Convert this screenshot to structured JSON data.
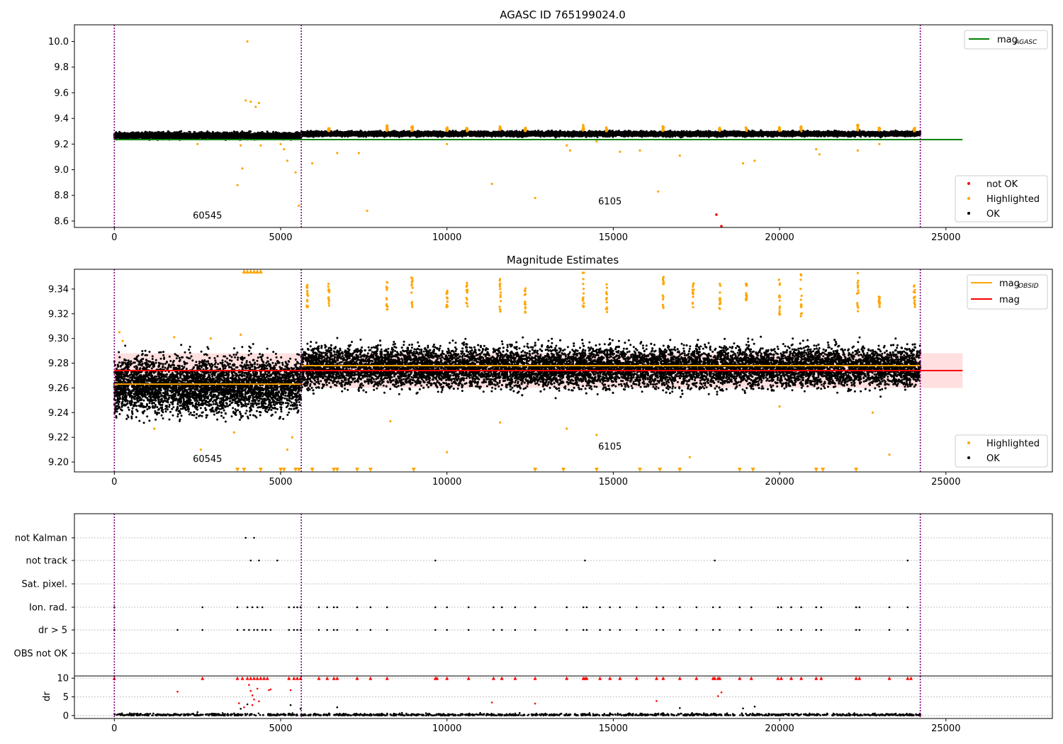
{
  "colors": {
    "ok": "#000000",
    "highlighted": "#ffa500",
    "not_ok": "#ff0000",
    "agasc_line": "#008000",
    "obsid_line": "#ffa500",
    "mag_line": "#ff0000",
    "mag_band": "#ffd7d7",
    "obsid_divider": "#800080",
    "grid": "#b0b0b0"
  },
  "chart_data": [
    {
      "type": "scatter",
      "title": "AGASC ID 765199024.0",
      "xlim": [
        -1200,
        28200
      ],
      "ylim": [
        8.55,
        10.13
      ],
      "x_ticks": [
        0,
        5000,
        10000,
        15000,
        20000,
        25000
      ],
      "x_tick_labels": [
        "0",
        "5000",
        "10000",
        "15000",
        "20000",
        "25000"
      ],
      "y_ticks": [
        8.6,
        8.8,
        9.0,
        9.2,
        9.4,
        9.6,
        9.8,
        10.0
      ],
      "y_tick_labels": [
        "8.6",
        "8.8",
        "9.0",
        "9.2",
        "9.4",
        "9.6",
        "9.8",
        "10.0"
      ],
      "obsid_boundaries": [
        0,
        5620,
        24230
      ],
      "obsid_labels": [
        {
          "text": "60545",
          "x": 2800,
          "y": 8.62
        },
        {
          "text": "6105",
          "x": 14900,
          "y": 8.73
        }
      ],
      "lines": [
        {
          "name": "agasc",
          "legend_label": "mag",
          "legend_sub": "AGASC",
          "x": [
            0,
            25500
          ],
          "y": [
            9.235,
            9.235
          ]
        }
      ],
      "ok_band": [
        {
          "x": [
            0,
            5620
          ],
          "center": 9.265,
          "spread": 0.012
        },
        {
          "x": [
            5620,
            24230
          ],
          "center": 9.28,
          "spread": 0.009
        }
      ],
      "highlighted_points": [
        [
          4000,
          10.0
        ],
        [
          3950,
          9.54
        ],
        [
          4100,
          9.53
        ],
        [
          4250,
          9.49
        ],
        [
          4350,
          9.52
        ],
        [
          3700,
          8.88
        ],
        [
          3850,
          9.01
        ],
        [
          3800,
          9.19
        ],
        [
          4400,
          9.19
        ],
        [
          2500,
          9.2
        ],
        [
          5000,
          9.2
        ],
        [
          5100,
          9.16
        ],
        [
          5200,
          9.07
        ],
        [
          5450,
          8.98
        ],
        [
          5550,
          8.72
        ],
        [
          5950,
          9.05
        ],
        [
          6700,
          9.13
        ],
        [
          7350,
          9.13
        ],
        [
          7600,
          8.68
        ],
        [
          10000,
          9.2
        ],
        [
          11350,
          8.89
        ],
        [
          12650,
          8.78
        ],
        [
          13600,
          9.19
        ],
        [
          13700,
          9.15
        ],
        [
          14500,
          9.22
        ],
        [
          15200,
          9.14
        ],
        [
          15800,
          9.15
        ],
        [
          16350,
          8.83
        ],
        [
          17000,
          9.11
        ],
        [
          18900,
          9.05
        ],
        [
          19250,
          9.07
        ],
        [
          21100,
          9.16
        ],
        [
          21200,
          9.12
        ],
        [
          22350,
          9.15
        ],
        [
          23000,
          9.2
        ]
      ],
      "highlighted_clusters": [
        {
          "x": 6450,
          "y_from": 9.3,
          "y_to": 9.34
        },
        {
          "x": 8200,
          "y_from": 9.3,
          "y_to": 9.35
        },
        {
          "x": 8950,
          "y_from": 9.3,
          "y_to": 9.34
        },
        {
          "x": 10000,
          "y_from": 9.3,
          "y_to": 9.33
        },
        {
          "x": 10600,
          "y_from": 9.3,
          "y_to": 9.33
        },
        {
          "x": 11600,
          "y_from": 9.3,
          "y_to": 9.34
        },
        {
          "x": 12350,
          "y_from": 9.3,
          "y_to": 9.33
        },
        {
          "x": 14100,
          "y_from": 9.3,
          "y_to": 9.35
        },
        {
          "x": 14800,
          "y_from": 9.3,
          "y_to": 9.33
        },
        {
          "x": 16500,
          "y_from": 9.3,
          "y_to": 9.34
        },
        {
          "x": 18200,
          "y_from": 9.3,
          "y_to": 9.33
        },
        {
          "x": 19000,
          "y_from": 9.3,
          "y_to": 9.33
        },
        {
          "x": 20000,
          "y_from": 9.3,
          "y_to": 9.34
        },
        {
          "x": 20650,
          "y_from": 9.3,
          "y_to": 9.34
        },
        {
          "x": 22350,
          "y_from": 9.3,
          "y_to": 9.35
        },
        {
          "x": 23000,
          "y_from": 9.3,
          "y_to": 9.33
        },
        {
          "x": 24050,
          "y_from": 9.3,
          "y_to": 9.33
        }
      ],
      "not_ok_points": [
        [
          18100,
          8.65
        ],
        [
          18250,
          8.56
        ]
      ],
      "legends": [
        {
          "placement": "upper-right",
          "entries": [
            {
              "kind": "line",
              "color": "agasc_line",
              "label": "mag",
              "sub": "AGASC"
            }
          ]
        },
        {
          "placement": "lower-right",
          "entries": [
            {
              "kind": "marker",
              "color": "not_ok",
              "label": "not OK"
            },
            {
              "kind": "marker",
              "color": "highlighted",
              "label": "Highlighted"
            },
            {
              "kind": "marker",
              "color": "ok",
              "label": "OK"
            }
          ]
        }
      ]
    },
    {
      "type": "scatter",
      "title": "Magnitude Estimates",
      "xlim": [
        -1200,
        28200
      ],
      "ylim": [
        9.192,
        9.356
      ],
      "x_ticks": [
        0,
        5000,
        10000,
        15000,
        20000,
        25000
      ],
      "x_tick_labels": [
        "0",
        "5000",
        "10000",
        "15000",
        "20000",
        "25000"
      ],
      "y_ticks": [
        9.2,
        9.22,
        9.24,
        9.26,
        9.28,
        9.3,
        9.32,
        9.34
      ],
      "y_tick_labels": [
        "9.20",
        "9.22",
        "9.24",
        "9.26",
        "9.28",
        "9.30",
        "9.32",
        "9.34"
      ],
      "obsid_boundaries": [
        0,
        5620,
        24230
      ],
      "obsid_labels": [
        {
          "text": "60545",
          "x": 2800,
          "y": 9.2
        },
        {
          "text": "6105",
          "x": 14900,
          "y": 9.21
        }
      ],
      "lines": [
        {
          "name": "mag_obsid_1",
          "x": [
            0,
            5620
          ],
          "y": [
            9.263,
            9.263
          ],
          "color": "obsid_line"
        },
        {
          "name": "mag_obsid_2",
          "x": [
            5620,
            24230
          ],
          "y": [
            9.278,
            9.278
          ],
          "color": "obsid_line"
        },
        {
          "name": "mag",
          "x": [
            0,
            25500
          ],
          "y": [
            9.274,
            9.274
          ],
          "color": "mag_line"
        }
      ],
      "band": {
        "x": [
          0,
          25500
        ],
        "y": [
          9.26,
          9.288
        ]
      },
      "ok_band": [
        {
          "x": [
            0,
            5620
          ],
          "center": 9.262,
          "spread": 0.011
        },
        {
          "x": [
            5620,
            24230
          ],
          "center": 9.277,
          "spread": 0.008
        }
      ],
      "highlighted_points": [
        [
          150,
          9.305
        ],
        [
          250,
          9.298
        ],
        [
          1200,
          9.227
        ],
        [
          2600,
          9.21
        ],
        [
          3600,
          9.224
        ],
        [
          5200,
          9.21
        ],
        [
          5350,
          9.22
        ],
        [
          5800,
          9.33
        ],
        [
          10000,
          9.208
        ],
        [
          13600,
          9.227
        ],
        [
          14500,
          9.222
        ],
        [
          17300,
          9.204
        ],
        [
          23300,
          9.206
        ],
        [
          11600,
          9.232
        ],
        [
          8300,
          9.233
        ],
        [
          1800,
          9.301
        ],
        [
          3800,
          9.303
        ],
        [
          2900,
          9.3
        ],
        [
          20000,
          9.245
        ],
        [
          22800,
          9.24
        ]
      ],
      "highlighted_clusters": [
        {
          "x": 5800,
          "y_from": 9.325,
          "y_to": 9.345
        },
        {
          "x": 6450,
          "y_from": 9.325,
          "y_to": 9.345
        },
        {
          "x": 8200,
          "y_from": 9.322,
          "y_to": 9.35
        },
        {
          "x": 8950,
          "y_from": 9.325,
          "y_to": 9.35
        },
        {
          "x": 10000,
          "y_from": 9.325,
          "y_to": 9.34
        },
        {
          "x": 10600,
          "y_from": 9.325,
          "y_to": 9.345
        },
        {
          "x": 11600,
          "y_from": 9.32,
          "y_to": 9.35
        },
        {
          "x": 12350,
          "y_from": 9.32,
          "y_to": 9.345
        },
        {
          "x": 14100,
          "y_from": 9.325,
          "y_to": 9.355
        },
        {
          "x": 14800,
          "y_from": 9.32,
          "y_to": 9.345
        },
        {
          "x": 16500,
          "y_from": 9.32,
          "y_to": 9.35
        },
        {
          "x": 17400,
          "y_from": 9.325,
          "y_to": 9.345
        },
        {
          "x": 18200,
          "y_from": 9.32,
          "y_to": 9.345
        },
        {
          "x": 19000,
          "y_from": 9.33,
          "y_to": 9.345
        },
        {
          "x": 20000,
          "y_from": 9.318,
          "y_to": 9.348
        },
        {
          "x": 20650,
          "y_from": 9.318,
          "y_to": 9.352
        },
        {
          "x": 22350,
          "y_from": 9.32,
          "y_to": 9.355
        },
        {
          "x": 23000,
          "y_from": 9.325,
          "y_to": 9.335
        },
        {
          "x": 24050,
          "y_from": 9.325,
          "y_to": 9.345
        }
      ],
      "offscale_high_x": [
        3900,
        4000,
        4100,
        4200,
        4300,
        4400
      ],
      "offscale_low_x": [
        3700,
        3900,
        4400,
        5000,
        5100,
        5450,
        5550,
        5950,
        6600,
        6700,
        7300,
        7700,
        9000,
        12650,
        13500,
        14500,
        15800,
        16400,
        17000,
        18800,
        19200,
        21100,
        21300,
        22300
      ],
      "legends": [
        {
          "placement": "upper-right",
          "entries": [
            {
              "kind": "line",
              "color": "obsid_line",
              "label": "mag",
              "sub": "OBSID"
            },
            {
              "kind": "line",
              "color": "mag_line",
              "label": "mag",
              "sub": ""
            }
          ]
        },
        {
          "placement": "lower-right",
          "entries": [
            {
              "kind": "marker",
              "color": "highlighted",
              "label": "Highlighted"
            },
            {
              "kind": "marker",
              "color": "ok",
              "label": "OK"
            }
          ]
        }
      ]
    },
    {
      "type": "scatter",
      "title": "",
      "xlim": [
        -1200,
        28200
      ],
      "categories": [
        "not Kalman",
        "not track",
        "Sat. pixel.",
        "Ion. rad.",
        "dr > 5",
        "OBS not OK"
      ],
      "obsid_boundaries": [
        0,
        5620,
        24230
      ],
      "flag_points": {
        "not Kalman": [
          3950,
          4200
        ],
        "not track": [
          4100,
          4350,
          4900,
          9650,
          14150,
          18050,
          23850
        ],
        "Sat. pixel.": [],
        "Ion. rad.": [
          0,
          2650,
          3700,
          4000,
          4150,
          4300,
          4450,
          5250,
          5400,
          5500,
          5600,
          6150,
          6400,
          6600,
          6700,
          7300,
          7700,
          8200,
          9650,
          10000,
          10650,
          11400,
          11650,
          12050,
          12650,
          13600,
          14100,
          14200,
          14600,
          14900,
          15200,
          15700,
          16300,
          16500,
          17000,
          17500,
          18000,
          18200,
          18800,
          19150,
          19950,
          20050,
          20350,
          20650,
          21100,
          21250,
          22300,
          22400,
          23300,
          23850
        ],
        "dr > 5": [
          0,
          1900,
          2650,
          3700,
          3900,
          4050,
          4200,
          4300,
          4450,
          4550,
          4700,
          5250,
          5400,
          5500,
          5600,
          6150,
          6400,
          6600,
          6700,
          7300,
          7700,
          8200,
          9650,
          10000,
          10650,
          11400,
          11650,
          12050,
          12650,
          13600,
          14100,
          14200,
          14600,
          14900,
          15200,
          15700,
          16300,
          16500,
          17000,
          17500,
          18000,
          18200,
          18800,
          19150,
          19950,
          20050,
          20350,
          20650,
          21100,
          21250,
          22300,
          22400,
          23300,
          23850
        ],
        "OBS not OK": []
      }
    },
    {
      "type": "scatter",
      "title": "",
      "ylabel": "dr",
      "xlim": [
        -1200,
        28200
      ],
      "ylim": [
        -0.8,
        10.6
      ],
      "x_ticks": [
        0,
        5000,
        10000,
        15000,
        20000,
        25000
      ],
      "x_tick_labels": [
        "0",
        "5000",
        "10000",
        "15000",
        "20000",
        "25000"
      ],
      "y_ticks": [
        0,
        5,
        10
      ],
      "y_tick_labels": [
        "0",
        "5",
        "10"
      ],
      "obsid_boundaries": [
        0,
        5620,
        24230
      ],
      "capped_x": [
        0,
        2650,
        3700,
        3850,
        4000,
        4100,
        4200,
        4300,
        4400,
        4500,
        4600,
        5250,
        5400,
        5500,
        5600,
        6150,
        6400,
        6600,
        6700,
        7300,
        7700,
        8200,
        9650,
        9700,
        10000,
        10650,
        11400,
        11650,
        12050,
        12650,
        13600,
        14100,
        14150,
        14200,
        14600,
        14900,
        15200,
        15700,
        16300,
        16500,
        17000,
        17500,
        18000,
        18050,
        18150,
        18200,
        18800,
        19150,
        19950,
        20050,
        20350,
        20650,
        21100,
        21250,
        22300,
        22400,
        23300,
        23850,
        23950
      ],
      "red_points": [
        [
          1900,
          6.4
        ],
        [
          3750,
          3.3
        ],
        [
          3900,
          2.2
        ],
        [
          4050,
          8.2
        ],
        [
          4100,
          6.6
        ],
        [
          4150,
          5.4
        ],
        [
          4200,
          4.3
        ],
        [
          4300,
          7.2
        ],
        [
          4350,
          3.8
        ],
        [
          4150,
          2.8
        ],
        [
          4650,
          6.8
        ],
        [
          4700,
          7.0
        ],
        [
          5300,
          6.8
        ],
        [
          11350,
          3.5
        ],
        [
          12650,
          3.2
        ],
        [
          16300,
          3.9
        ],
        [
          18150,
          5.2
        ],
        [
          18250,
          6.2
        ]
      ],
      "black_points": [
        [
          2500,
          0.9
        ],
        [
          3800,
          1.8
        ],
        [
          4000,
          3.0
        ],
        [
          5300,
          2.8
        ],
        [
          5600,
          1.8
        ],
        [
          6700,
          2.2
        ],
        [
          17000,
          2.0
        ],
        [
          18900,
          1.9
        ],
        [
          19250,
          2.4
        ]
      ]
    }
  ]
}
